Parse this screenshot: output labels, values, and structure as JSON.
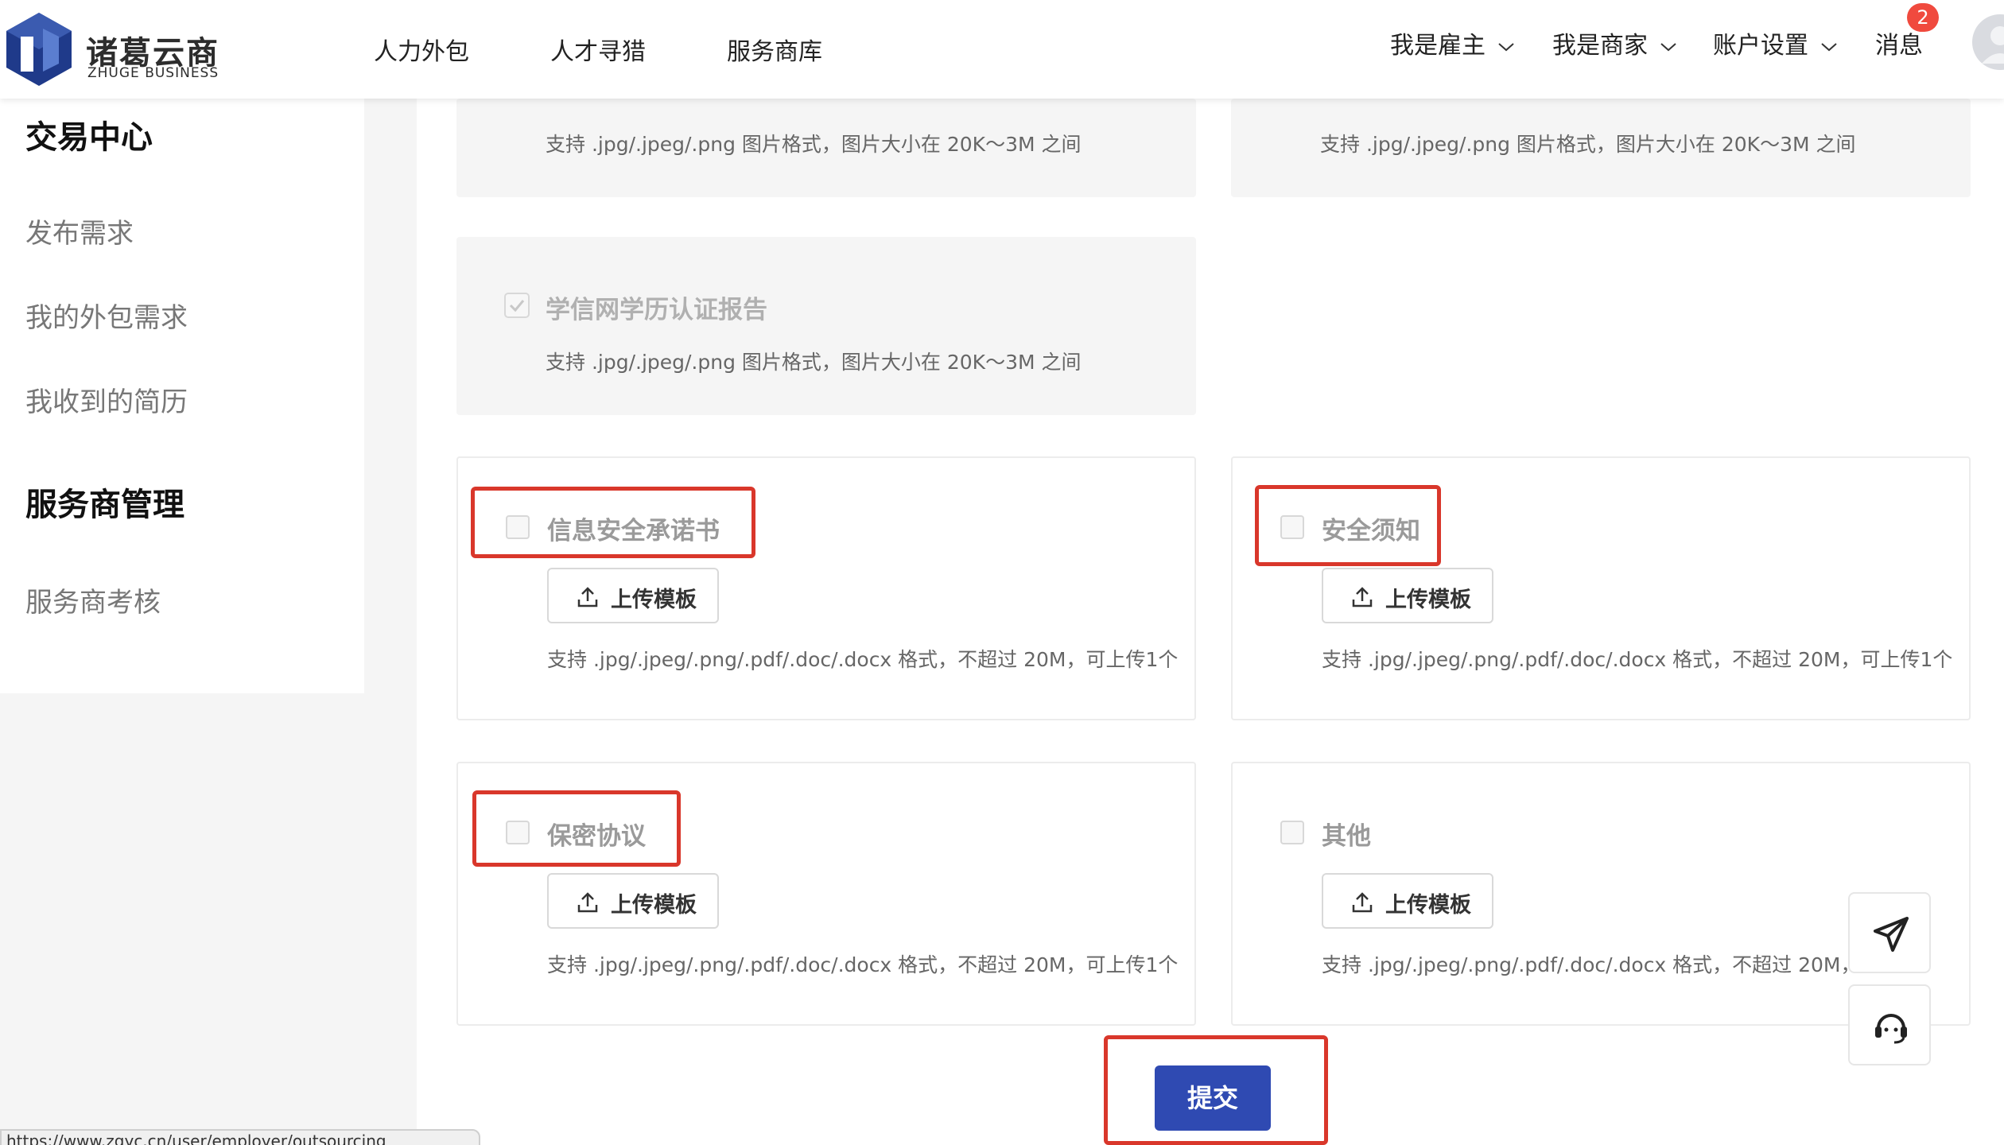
{
  "brand": {
    "name_cn": "诸葛云商",
    "name_en": "ZHUGE BUSINESS",
    "colors": {
      "primary": "#2f4ab2",
      "logo_dark": "#1f3a8a",
      "logo_light": "#5b7ed0",
      "badge": "#f04a3e",
      "highlight": "#d9372b"
    }
  },
  "nav": {
    "main": [
      "人力外包",
      "人才寻猎",
      "服务商库"
    ],
    "right": [
      {
        "label": "我是雇主",
        "icon": "chevron-down-icon"
      },
      {
        "label": "我是商家",
        "icon": "chevron-down-icon"
      },
      {
        "label": "账户设置",
        "icon": "chevron-down-icon"
      }
    ],
    "messages": {
      "label": "消息",
      "badge": "2"
    }
  },
  "sidebar": {
    "section1_title": "交易中心",
    "section1_items": [
      "发布需求",
      "我的外包需求",
      "我收到的简历"
    ],
    "section2_title": "服务商管理",
    "section2_items": [
      "服务商考核"
    ]
  },
  "uploads": {
    "image_hint": "支持 .jpg/.jpeg/.png 图片格式，图片大小在 20K～3M 之间",
    "doc_hint": "支持 .jpg/.jpeg/.png/.pdf/.doc/.docx 格式，不超过 20M，可上传1个",
    "doc_hint_truncated": "支持 .jpg/.jpeg/.png/.pdf/.doc/.docx 格式，不超过 20M，可",
    "xuexin_label": "学信网学历认证报告",
    "upload_button": "上传模板",
    "items": [
      {
        "label": "信息安全承诺书"
      },
      {
        "label": "安全须知"
      },
      {
        "label": "保密协议"
      },
      {
        "label": "其他"
      }
    ]
  },
  "actions": {
    "submit": "提交"
  },
  "floating": [
    "send-icon",
    "customer-service-icon"
  ],
  "status_bar": {
    "url": "https://www.zgyc.cn/user/employer/outsourcing"
  }
}
